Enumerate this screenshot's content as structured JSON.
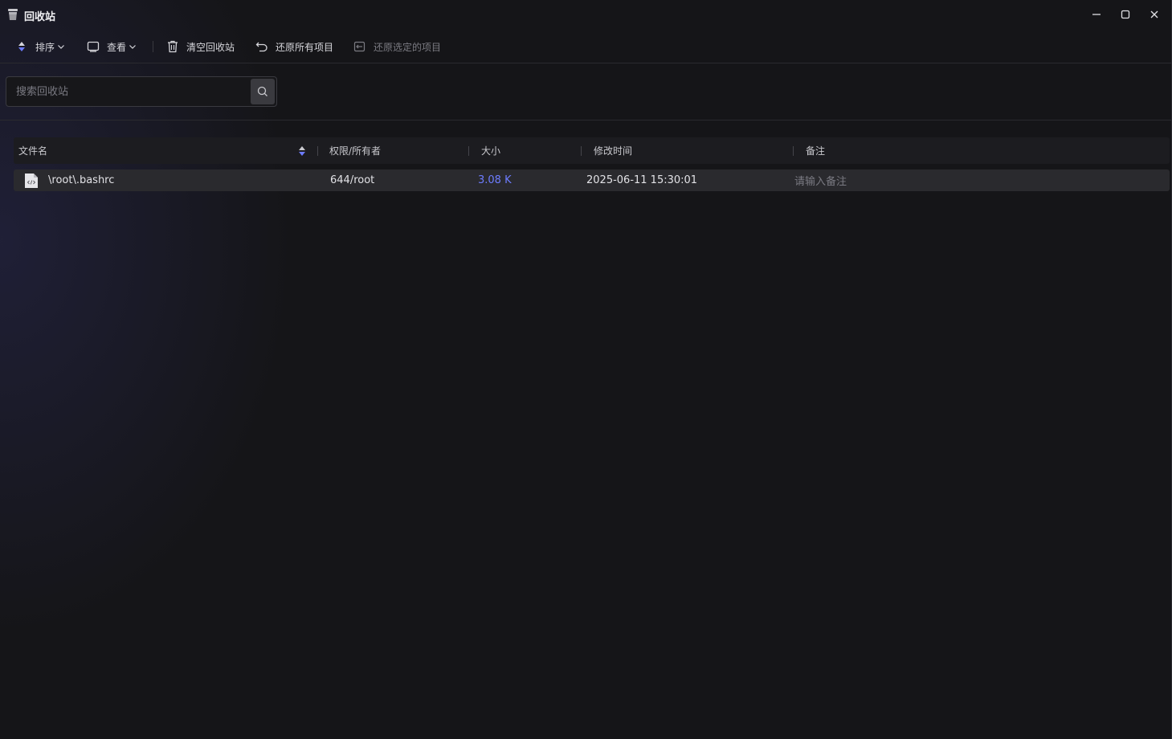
{
  "window": {
    "title": "回收站",
    "controls": [
      "minimize-icon",
      "maximize-icon",
      "close-icon"
    ]
  },
  "toolbar": {
    "sort_label": "排序",
    "view_label": "查看",
    "empty_label": "清空回收站",
    "restore_all_label": "还原所有项目",
    "restore_selected_label": "还原选定的项目"
  },
  "search": {
    "placeholder": "搜索回收站"
  },
  "table": {
    "columns": {
      "name": "文件名",
      "perm": "权限/所有者",
      "size": "大小",
      "mtime": "修改时间",
      "note": "备注"
    },
    "rows": [
      {
        "name": "\\root\\.bashrc",
        "perm": "644/root",
        "size": "3.08 K",
        "mtime": "2025-06-11 15:30:01",
        "note_placeholder": "请输入备注"
      }
    ]
  },
  "colors": {
    "accent": "#6d7cff",
    "background": "#151518",
    "row_selected": "#2a2a2e"
  }
}
